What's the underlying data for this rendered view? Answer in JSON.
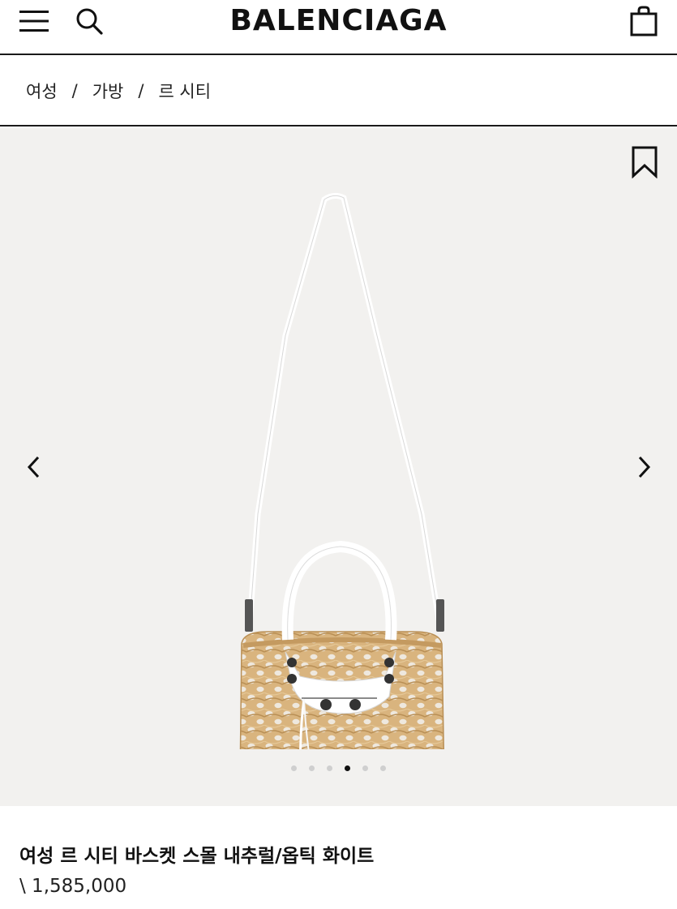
{
  "header": {
    "brand": "BALENCIAGA",
    "icons": [
      "menu-icon",
      "search-icon",
      "shopping-bag-icon"
    ]
  },
  "breadcrumb": {
    "items": [
      "여성",
      "가방",
      "르 시티"
    ],
    "separator": "/"
  },
  "gallery": {
    "image_count": 6,
    "active_index": 3,
    "icons": [
      "bookmark-icon",
      "chevron-left-icon",
      "chevron-right-icon"
    ],
    "colors": {
      "background": "#f2f1ef",
      "raffia": "#d9b47e",
      "leather": "#ffffff"
    }
  },
  "product": {
    "title": "여성 르 시티 바스켓 스몰 내추럴/옵틱 화이트",
    "price": "\\ 1,585,000"
  }
}
